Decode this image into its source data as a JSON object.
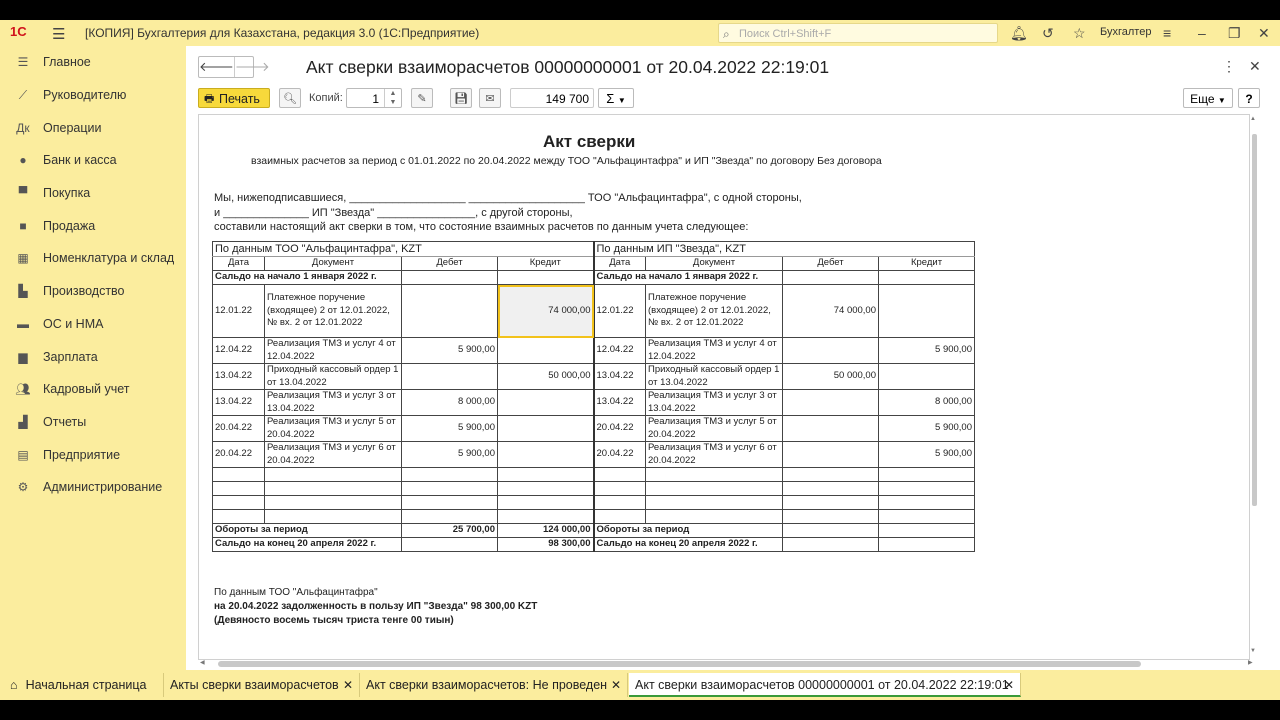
{
  "app": {
    "logo": "1С",
    "title": "[КОПИЯ] Бухгалтерия для Казахстана, редакция 3.0  (1С:Предприятие)",
    "search_placeholder": "Поиск Ctrl+Shift+F",
    "user": "Бухгалтер"
  },
  "sidebar": {
    "items": [
      {
        "label": "Главное",
        "icon": "menu-icon"
      },
      {
        "label": "Руководителю",
        "icon": "chart-line-icon"
      },
      {
        "label": "Операции",
        "icon": "operations-icon"
      },
      {
        "label": "Банк и касса",
        "icon": "coins-icon"
      },
      {
        "label": "Покупка",
        "icon": "cart-icon"
      },
      {
        "label": "Продажа",
        "icon": "bag-icon"
      },
      {
        "label": "Номенклатура и склад",
        "icon": "grid-icon"
      },
      {
        "label": "Производство",
        "icon": "factory-icon"
      },
      {
        "label": "ОС и НМА",
        "icon": "truck-icon"
      },
      {
        "label": "Зарплата",
        "icon": "wallet-icon"
      },
      {
        "label": "Кадровый учет",
        "icon": "people-icon"
      },
      {
        "label": "Отчеты",
        "icon": "bar-chart-icon"
      },
      {
        "label": "Предприятие",
        "icon": "document-icon"
      },
      {
        "label": "Администрирование",
        "icon": "gear-icon"
      }
    ]
  },
  "document": {
    "title": "Акт сверки взаиморасчетов 00000000001 от 20.04.2022 22:19:01"
  },
  "toolbar": {
    "print_label": "Печать",
    "copies_label": "Копий:",
    "copies_value": "1",
    "sum_value": "149 700",
    "sigma": "Σ",
    "more_label": "Еще",
    "help_label": "?"
  },
  "sheet": {
    "title": "Акт сверки",
    "subtitle": "взаимных расчетов за период с 01.01.2022 по 20.04.2022 между ТОО \"Альфацинтафра\" и ИП \"Звезда\" по договору Без договора",
    "line1": "Мы, нижеподписавшиеся, ___________________ ___________________ ТОО \"Альфацинтафра\", с одной стороны,",
    "line2": "и ______________ ИП \"Звезда\" ________________, с другой стороны,",
    "line3": "составили настоящий акт сверки в том, что состояние взаимных расчетов по данным учета следующее:",
    "left_header": "По данным ТОО \"Альфацинтафра\", KZT",
    "right_header": "По данным ИП \"Звезда\", KZT",
    "col_date": "Дата",
    "col_doc": "Документ",
    "col_debit": "Дебет",
    "col_credit": "Кредит",
    "opening_label": "Сальдо на начало 1 января 2022 г.",
    "rows": [
      {
        "l_date": "12.01.22",
        "l_doc": "Платежное поручение (входящее) 2 от 12.01.2022,  № вх. 2 от 12.01.2022",
        "l_debit": "",
        "l_credit": "74 000,00",
        "r_date": "12.01.22",
        "r_doc": "Платежное поручение (входящее) 2 от 12.01.2022,  № вх. 2 от 12.01.2022",
        "r_debit": "74 000,00",
        "r_credit": ""
      },
      {
        "l_date": "12.04.22",
        "l_doc": "Реализация ТМЗ и услуг 4 от 12.04.2022",
        "l_debit": "5 900,00",
        "l_credit": "",
        "r_date": "12.04.22",
        "r_doc": "Реализация ТМЗ и услуг 4 от 12.04.2022",
        "r_debit": "",
        "r_credit": "5 900,00"
      },
      {
        "l_date": "13.04.22",
        "l_doc": "Приходный кассовый ордер 1 от 13.04.2022",
        "l_debit": "",
        "l_credit": "50 000,00",
        "r_date": "13.04.22",
        "r_doc": "Приходный кассовый ордер 1 от 13.04.2022",
        "r_debit": "50 000,00",
        "r_credit": ""
      },
      {
        "l_date": "13.04.22",
        "l_doc": "Реализация ТМЗ и услуг 3 от 13.04.2022",
        "l_debit": "8 000,00",
        "l_credit": "",
        "r_date": "13.04.22",
        "r_doc": "Реализация ТМЗ и услуг 3 от 13.04.2022",
        "r_debit": "",
        "r_credit": "8 000,00"
      },
      {
        "l_date": "20.04.22",
        "l_doc": "Реализация ТМЗ и услуг 5 от 20.04.2022",
        "l_debit": "5 900,00",
        "l_credit": "",
        "r_date": "20.04.22",
        "r_doc": "Реализация ТМЗ и услуг 5 от 20.04.2022",
        "r_debit": "",
        "r_credit": "5 900,00"
      },
      {
        "l_date": "20.04.22",
        "l_doc": "Реализация ТМЗ и услуг 6 от 20.04.2022",
        "l_debit": "5 900,00",
        "l_credit": "",
        "r_date": "20.04.22",
        "r_doc": "Реализация ТМЗ и услуг 6 от 20.04.2022",
        "r_debit": "",
        "r_credit": "5 900,00"
      }
    ],
    "turnover_label": "Обороты за период",
    "turnover_debit": "25 700,00",
    "turnover_credit": "124 000,00",
    "closing_label": "Сальдо на конец 20 апреля 2022 г.",
    "closing_credit": "98 300,00",
    "foot1": "По данным ТОО \"Альфацинтафра\"",
    "foot2": "на 20.04.2022 задолженность в пользу ИП \"Звезда\"  98 300,00  KZT",
    "foot3": "(Девяносто восемь тысяч триста тенге 00 тиын)"
  },
  "tabs": [
    {
      "label": "Начальная страница"
    },
    {
      "label": "Акты сверки взаиморасчетов"
    },
    {
      "label": "Акт сверки взаиморасчетов: Не проведен"
    },
    {
      "label": "Акт сверки взаиморасчетов 00000000001 от 20.04.2022 22:19:01"
    }
  ],
  "colors": {
    "app_background": "#fbed9e",
    "print_button": "#f7d93b",
    "active_tab_underline": "#3a9a3a",
    "selected_cell_border": "#f2c21b"
  }
}
